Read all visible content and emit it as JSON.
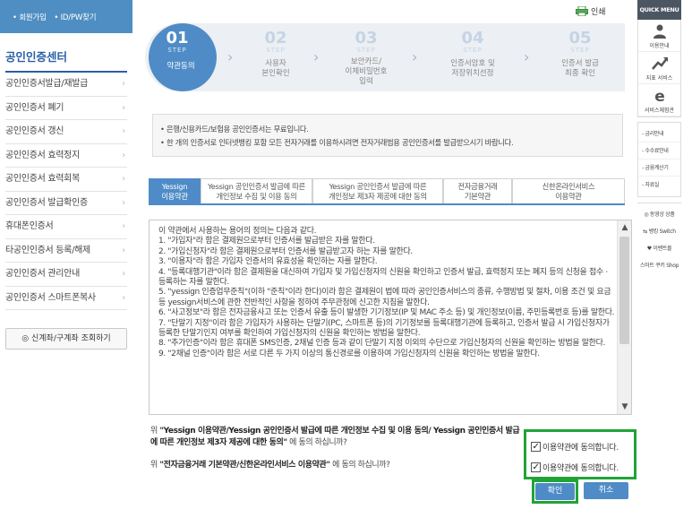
{
  "sidebar": {
    "top_links": [
      "• 회원가입",
      "• ID/PW찾기"
    ],
    "title": "공인인증센터",
    "items": [
      "공인인증서발급/재발급",
      "공인인증서 폐기",
      "공인인증서 갱신",
      "공인인증서 효력정지",
      "공인인증서 효력회복",
      "공인인증서 발급확인증",
      "휴대폰인증서",
      "타공인인증서 등록/해제",
      "공인인증서 관리안내",
      "공인인증서 스마트폰복사"
    ],
    "check_button": "◎ 신계좌/구계좌 조회하기"
  },
  "print_label": "인쇄",
  "steps": [
    {
      "num": "01",
      "sub": "STEP",
      "label": "약관동의",
      "active": true
    },
    {
      "num": "02",
      "sub": "STEP",
      "label": "사용자\n본인확인",
      "active": false
    },
    {
      "num": "03",
      "sub": "STEP",
      "label": "보안카드/\n이체비밀번호\n입력",
      "active": false
    },
    {
      "num": "04",
      "sub": "STEP",
      "label": "인증서암호 및\n저장위치선정",
      "active": false
    },
    {
      "num": "05",
      "sub": "STEP",
      "label": "인증서 발급\n최종 확인",
      "active": false
    }
  ],
  "notice": [
    "은행/신용카드/보험용 공인인증서는 무료입니다.",
    "한 개의 인증서로 인터넷뱅킹 포함 모든 전자거래를 이용하시려면 전자거래범용 공인인증서를 발급받으시기 바랍니다."
  ],
  "tabs": [
    {
      "label": "Yessign\n이용약관",
      "active": true
    },
    {
      "label": "Yessign 공인인증서 발급에 따른\n개인정보 수집 및 이용 동의",
      "active": false
    },
    {
      "label": "Yessign 공인인증서 발급에 따른\n개인정보 제3자 제공에 대한 동의",
      "active": false
    },
    {
      "label": "전자금융거래\n기본약관",
      "active": false
    },
    {
      "label": "신한온라인서비스\n이용약관",
      "active": false
    }
  ],
  "terms": [
    "이 약관에서 사용하는 용어의 정의는 다음과 같다.",
    "1. \"가입자\"라 함은 결제원으로부터 인증서를 발급받은 자를 말한다.",
    "2. \"가입신청자\"라 함은 결제원으로부터 인증서를 발급받고자 하는 자를 말한다.",
    "3. \"이용자\"라 함은 가입자 인증서의 유효성을 확인하는 자를 말한다.",
    "4. \"등록대행기관\"이라 함은 결제원을 대신하여 가입자 및 가입신청자의 신원을 확인하고 인증서 발급, 효력정지 또는 폐지 등의 신청을 접수 · 등록하는 자를 말한다.",
    "5. \"yessign 인증업무준칙\"(이하 \"준칙\"이라 한다)이라 함은 결제원이 법에 따라 공인인증서비스의 종류, 수행방법 및 절차, 이용 조건 및 요금 등 yessign서비스에 관한 전반적인 사항을 정하여 주무관청에 신고한 지침을 말한다.",
    "6. \"사고정보\"라 함은 전자금융사고 또는 인증서 유출 등이 발생한 기기정보(IP 및 MAC 주소 등) 및 개인정보(이름, 주민등록번호 등)를 말한다.",
    "7. \"단말기 지정\"이라 함은 가입자가 사용하는 단말기(PC, 스마트폰 등)의 기기정보를 등록대행기관에 등록하고, 인증서 발급 시 가입신청자가 등록한 단말기인지 여부를 확인하여 가입신청자의 신원을 확인하는 방법을 말한다.",
    "8. \"추가인증\"이라 함은 휴대폰 SMS인증, 2채널 인증 등과 같이 단말기 지정 이외의 수단으로 가입신청자의 신원을 확인하는 방법을 말한다.",
    "9. \"2채널 인증\"이라 함은 서로 다른 두 가지 이상의 통신경로를 이용하여 가입신청자의 신원을 확인하는 방법을 말한다."
  ],
  "question1": {
    "prefix": "위 ",
    "bold": "\"Yessign 이용약관/Yessign 공인인증서 발급에 따른 개인정보 수집 및 이용 동의/ Yessign 공인인증서 발급에 따른 개인정보 제3자 제공에 대한 동의\"",
    "suffix": " 에 동의 하십니까?"
  },
  "question2": {
    "prefix": "위 ",
    "bold": "\"전자금융거래 기본약관/신한온라인서비스 이용약관\"",
    "suffix": " 에 동의 하십니까?"
  },
  "agree1": {
    "label": "이용약관에 동의합니다.",
    "checked": true
  },
  "agree2": {
    "label": "이용약관에 동의합니다.",
    "checked": true
  },
  "buttons": {
    "confirm": "확인",
    "cancel": "취소"
  },
  "quick_menu": {
    "title": "QUICK MENU",
    "icon_items": [
      "이용안내",
      "지표 서비스",
      "서비스체험관"
    ],
    "text_items": [
      "- 금리안내",
      "- 수수료안내",
      "- 금융계산기",
      "- 자료실"
    ],
    "link_items": [
      "◎ 동영상 상품",
      "⇆ 뱅킹 Switch",
      "♥ 이벤트몰",
      "스마트 쿠키 Shop"
    ]
  },
  "colors": {
    "accent": "#4f8cc7",
    "highlight": "#21a336"
  }
}
